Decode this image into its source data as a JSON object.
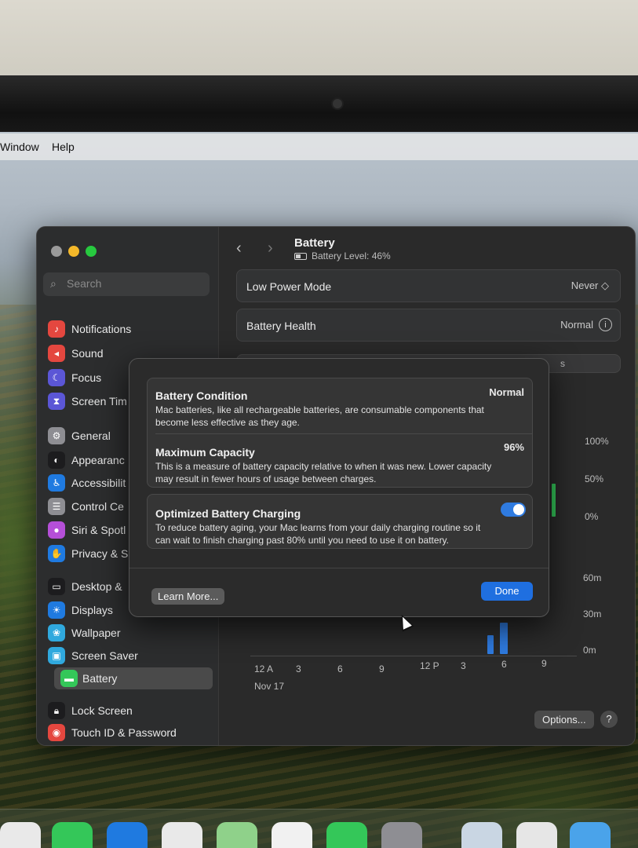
{
  "menubar": {
    "items": [
      "Window",
      "Help"
    ]
  },
  "window": {
    "sidebar": {
      "search_placeholder": "Search",
      "items": [
        {
          "label": "Notifications",
          "icon": "bell-icon",
          "color": "#e4473f"
        },
        {
          "label": "Sound",
          "icon": "speaker-icon",
          "color": "#e4473f"
        },
        {
          "label": "Focus",
          "icon": "moon-icon",
          "color": "#5b56d6"
        },
        {
          "label": "Screen Tim",
          "icon": "hourglass-icon",
          "color": "#5b56d6"
        },
        {
          "label": "General",
          "icon": "gear-icon",
          "color": "#8e8e93"
        },
        {
          "label": "Appearanc",
          "icon": "appearance-icon",
          "color": "#1c1c1e"
        },
        {
          "label": "Accessibilit",
          "icon": "accessibility-icon",
          "color": "#1f7ae0"
        },
        {
          "label": "Control Ce",
          "icon": "control-center-icon",
          "color": "#8e8e93"
        },
        {
          "label": "Siri & Spotl",
          "icon": "siri-icon",
          "color": "#b54fd8"
        },
        {
          "label": "Privacy & S",
          "icon": "hand-icon",
          "color": "#1f7ae0"
        },
        {
          "label": "Desktop &",
          "icon": "desktop-icon",
          "color": "#1c1c1e"
        },
        {
          "label": "Displays",
          "icon": "sun-icon",
          "color": "#1f7ae0"
        },
        {
          "label": "Wallpaper",
          "icon": "wallpaper-icon",
          "color": "#30a9de"
        },
        {
          "label": "Screen Saver",
          "icon": "screensaver-icon",
          "color": "#30a9de"
        },
        {
          "label": "Battery",
          "icon": "battery-icon",
          "color": "#34c759"
        },
        {
          "label": "Lock Screen",
          "icon": "lock-icon",
          "color": "#1c1c1e"
        },
        {
          "label": "Touch ID & Password",
          "icon": "fingerprint-icon",
          "color": "#e4473f"
        }
      ]
    },
    "header": {
      "title": "Battery",
      "subtitle": "Battery Level: 46%"
    },
    "rows": [
      {
        "label": "Low Power Mode",
        "value": "Never ◇"
      },
      {
        "label": "Battery Health",
        "value": "Normal"
      }
    ],
    "chart_labels": {
      "level_ticks": [
        "100%",
        "50%",
        "0%"
      ],
      "usage_ticks": [
        "60m",
        "30m",
        "0m"
      ],
      "x_ticks": [
        "12 A",
        "3",
        "6",
        "9",
        "12 P",
        "3",
        "6",
        "9"
      ],
      "date": "Nov 17",
      "partial_right_text": "s"
    },
    "footer": {
      "options_label": "Options...",
      "help_label": "?"
    }
  },
  "sheet": {
    "battery_condition": {
      "heading": "Battery Condition",
      "value": "Normal",
      "description": "Mac batteries, like all rechargeable batteries, are consumable components that become less effective as they age."
    },
    "maximum_capacity": {
      "heading": "Maximum Capacity",
      "value": "96%",
      "description": "This is a measure of battery capacity relative to when it was new. Lower capacity may result in fewer hours of usage between charges."
    },
    "optimized_charging": {
      "heading": "Optimized Battery Charging",
      "enabled": true,
      "description": "To reduce battery aging, your Mac learns from your daily charging routine so it can wait to finish charging past 80% until you need to use it on battery."
    },
    "learn_more_label": "Learn More...",
    "done_label": "Done"
  },
  "colors": {
    "accent": "#2f7be0",
    "window_bg": "#2a2a2a"
  }
}
